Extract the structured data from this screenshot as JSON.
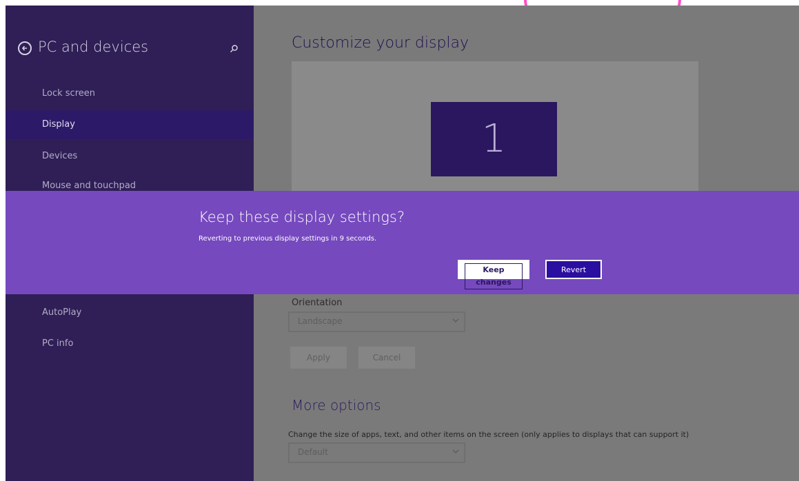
{
  "sidebar": {
    "title": "PC and devices",
    "items": [
      {
        "label": "Lock screen"
      },
      {
        "label": "Display"
      },
      {
        "label": "Devices"
      },
      {
        "label": "Mouse and touchpad"
      },
      {
        "label": "AutoPlay"
      },
      {
        "label": "PC info"
      }
    ],
    "active_item": "Display"
  },
  "main": {
    "title": "Customize your display",
    "monitor_number": "1",
    "orientation": {
      "label": "Orientation",
      "value": "Landscape"
    },
    "apply_label": "Apply",
    "cancel_label": "Cancel",
    "more_options": {
      "title": "More options",
      "description": "Change the size of apps, text, and other items on the screen (only applies to displays that can support it)",
      "value": "Default"
    }
  },
  "dialog": {
    "title": "Keep these display settings?",
    "message": "Reverting to previous display settings in  9 seconds.",
    "keep_label": "Keep changes",
    "revert_label": "Revert"
  },
  "colors": {
    "sidebar_bg": "#2f1f56",
    "active_item_bg": "#2c1a68",
    "dialog_bg": "#7649be",
    "revert_bg": "#2a0fa0"
  }
}
